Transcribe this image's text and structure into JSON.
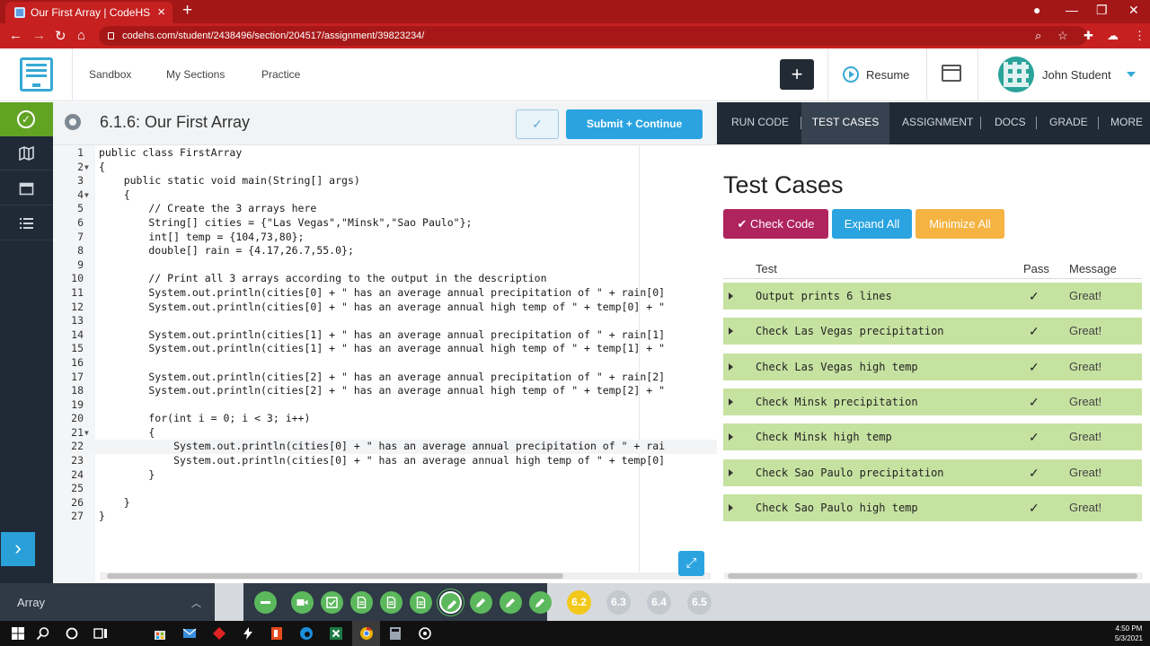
{
  "browser": {
    "tab_title": "Our First Array | CodeHS",
    "url": "codehs.com/student/2438496/section/204517/assignment/39823234/"
  },
  "header": {
    "nav": [
      "Sandbox",
      "My Sections",
      "Practice"
    ],
    "plus_label": "+",
    "resume_label": "Resume",
    "user_name": "John Student"
  },
  "editor": {
    "title": "6.1.6: Our First Array",
    "check_label": "✓",
    "submit_label": "Submit + Continue",
    "active_line": 22,
    "lines": [
      "public class FirstArray",
      "{",
      "    public static void main(String[] args)",
      "    {",
      "        // Create the 3 arrays here",
      "        String[] cities = {\"Las Vegas\",\"Minsk\",\"Sao Paulo\"};",
      "        int[] temp = {104,73,80};",
      "        double[] rain = {4.17,26.7,55.0};",
      "",
      "        // Print all 3 arrays according to the output in the description",
      "        System.out.println(cities[0] + \" has an average annual precipitation of \" + rain[0]",
      "        System.out.println(cities[0] + \" has an average annual high temp of \" + temp[0] + \"",
      "",
      "        System.out.println(cities[1] + \" has an average annual precipitation of \" + rain[1]",
      "        System.out.println(cities[1] + \" has an average annual high temp of \" + temp[1] + \"",
      "",
      "        System.out.println(cities[2] + \" has an average annual precipitation of \" + rain[2]",
      "        System.out.println(cities[2] + \" has an average annual high temp of \" + temp[2] + \"",
      "",
      "        for(int i = 0; i < 3; i++)",
      "        {",
      "            System.out.println(cities[0] + \" has an average annual precipitation of \" + rai",
      "            System.out.println(cities[0] + \" has an average annual high temp of \" + temp[0]",
      "        }",
      "",
      "    }",
      "}"
    ],
    "fold_lines": [
      2,
      4,
      21
    ]
  },
  "right_panel": {
    "tabs": [
      "RUN CODE",
      "TEST CASES",
      "ASSIGNMENT",
      "DOCS",
      "GRADE",
      "MORE"
    ],
    "active_tab": "TEST CASES",
    "heading": "Test Cases",
    "buttons": {
      "check_code": "✔ Check Code",
      "expand_all": "Expand All",
      "minimize_all": "Minimize All"
    },
    "columns": {
      "test": "Test",
      "pass": "Pass",
      "message": "Message"
    },
    "tests": [
      {
        "name": "Output prints 6 lines",
        "pass": "✓",
        "message": "Great!"
      },
      {
        "name": "Check Las Vegas precipitation",
        "pass": "✓",
        "message": "Great!"
      },
      {
        "name": "Check Las Vegas high temp",
        "pass": "✓",
        "message": "Great!"
      },
      {
        "name": "Check Minsk precipitation",
        "pass": "✓",
        "message": "Great!"
      },
      {
        "name": "Check Minsk high temp",
        "pass": "✓",
        "message": "Great!"
      },
      {
        "name": "Check Sao Paulo precipitation",
        "pass": "✓",
        "message": "Great!"
      },
      {
        "name": "Check Sao Paulo high temp",
        "pass": "✓",
        "message": "Great!"
      }
    ]
  },
  "bottom": {
    "unit": "Array",
    "sections": [
      "6.2",
      "6.3",
      "6.4",
      "6.5"
    ],
    "active_section": "6.2"
  },
  "taskbar": {
    "time": "4:50 PM",
    "date": "5/3/2021"
  },
  "colors": {
    "browser_red": "#c62020",
    "accent_blue": "#2aa3e0",
    "success_green": "#62a324",
    "check_code": "#b0245e",
    "minimize_all": "#f5b342",
    "test_row": "#c6e2a1",
    "active_section": "#f2c81b"
  }
}
